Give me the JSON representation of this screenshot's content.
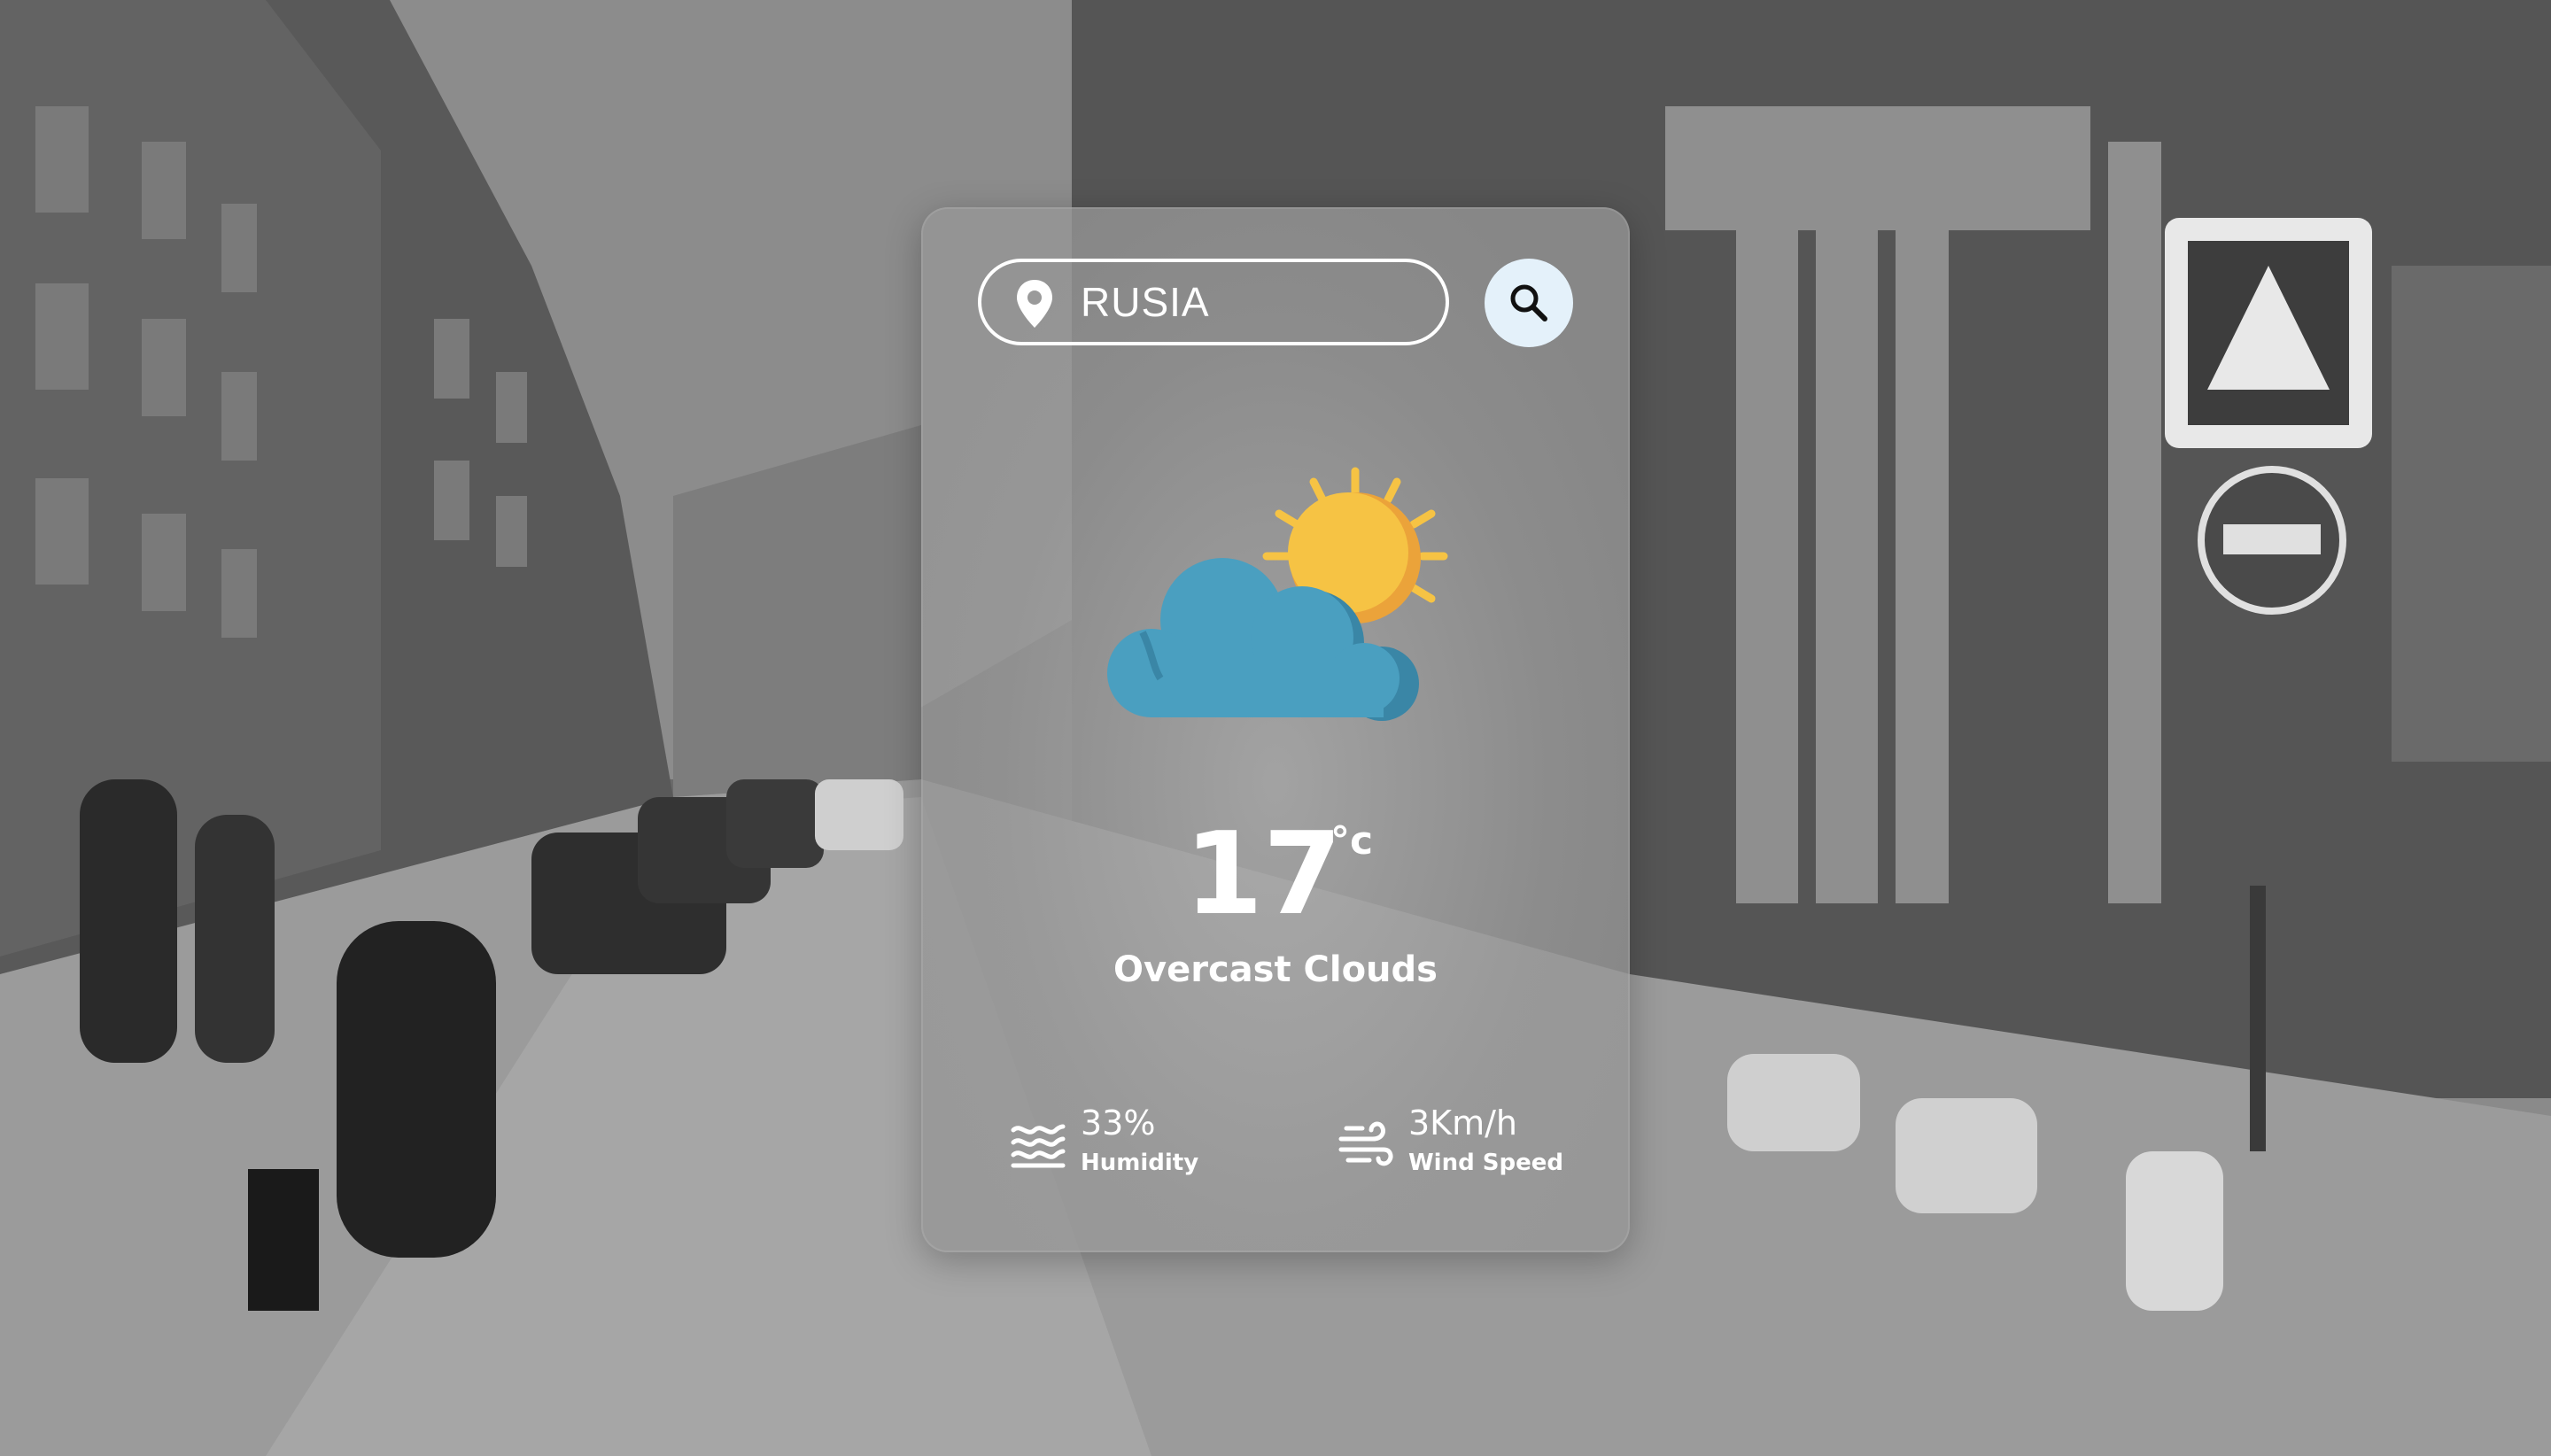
{
  "search": {
    "value": "RUSIA",
    "location_icon": "location-pin-icon",
    "button_icon": "search-icon"
  },
  "weather": {
    "icon": "sun-behind-cloud-icon",
    "temperature": "17",
    "unit": "°c",
    "description": "Overcast Clouds"
  },
  "details": {
    "humidity": {
      "icon": "humidity-waves-icon",
      "value": "33%",
      "label": "Humidity"
    },
    "wind": {
      "icon": "wind-icon",
      "value": "3Km/h",
      "label": "Wind Speed"
    }
  },
  "colors": {
    "card": "#9a9a9a",
    "search_button": "#e4f1fa",
    "sun": "#f6c344",
    "sun_shade": "#eba33a",
    "cloud": "#4a9fc0",
    "cloud_shade": "#3a86a6",
    "text": "#ffffff"
  }
}
